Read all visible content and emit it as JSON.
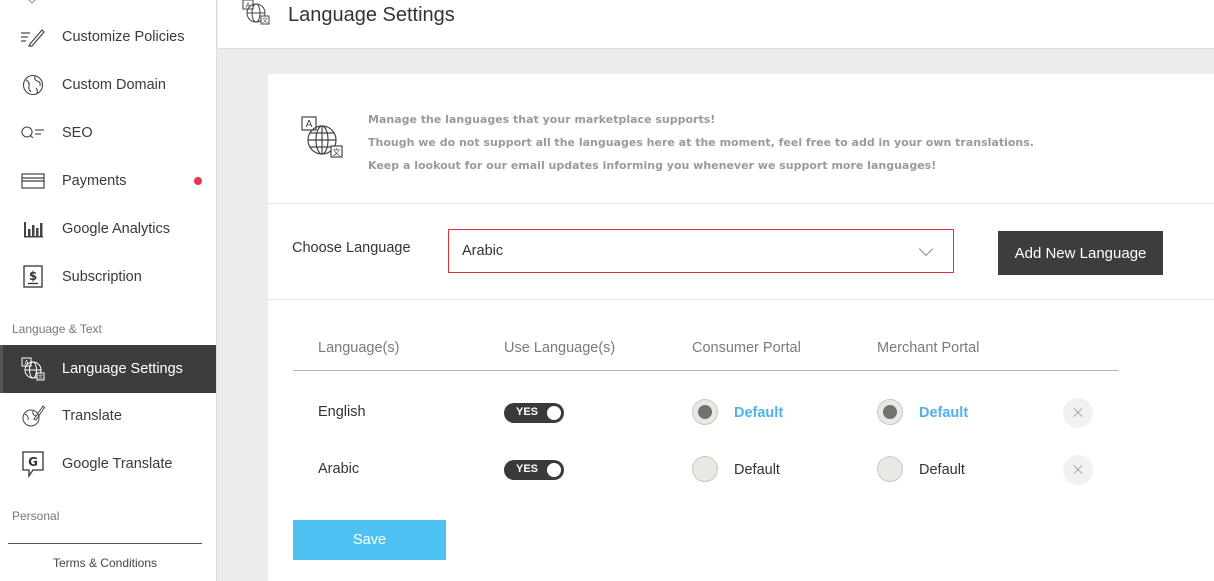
{
  "header": {
    "title": "Language Settings",
    "icon": "language-translate-icon"
  },
  "sidebar": {
    "items": [
      {
        "label": "Customize Policies",
        "icon": "pencil-lines-icon"
      },
      {
        "label": "Custom Domain",
        "icon": "globe-icon"
      },
      {
        "label": "SEO",
        "icon": "search-lines-icon"
      },
      {
        "label": "Payments",
        "icon": "card-icon",
        "badge_color": "#e8344e"
      },
      {
        "label": "Google Analytics",
        "icon": "bar-chart-icon"
      },
      {
        "label": "Subscription",
        "icon": "dollar-document-icon"
      },
      {
        "label": "Language Settings",
        "icon": "language-translate-icon",
        "active": true
      },
      {
        "label": "Translate",
        "icon": "globe-pen-icon"
      },
      {
        "label": "Google Translate",
        "icon": "google-translate-icon"
      }
    ],
    "sections": {
      "language_text": "Language & Text",
      "personal": "Personal"
    },
    "footer_link": "Terms & Conditions"
  },
  "info": {
    "lines": [
      "Manage the languages that your marketplace supports!",
      "Though we do not support all the languages here at the moment, feel free to add in your own translations.",
      "Keep a lookout for our email updates informing you whenever we support more languages!"
    ]
  },
  "choose": {
    "label": "Choose Language",
    "selected": "Arabic",
    "add_button": "Add New Language"
  },
  "table": {
    "headers": [
      "Language(s)",
      "Use Language(s)",
      "Consumer Portal",
      "Merchant Portal"
    ],
    "rows": [
      {
        "language": "English",
        "use": "YES",
        "consumer": "Default",
        "consumer_selected": true,
        "merchant": "Default",
        "merchant_selected": true
      },
      {
        "language": "Arabic",
        "use": "YES",
        "consumer": "Default",
        "consumer_selected": false,
        "merchant": "Default",
        "merchant_selected": false
      }
    ]
  },
  "save_button": "Save",
  "colors": {
    "accent": "#4ec3f3",
    "default_link": "#4db3ea",
    "dark": "#3d3d3d",
    "error_border": "#e0303e"
  }
}
